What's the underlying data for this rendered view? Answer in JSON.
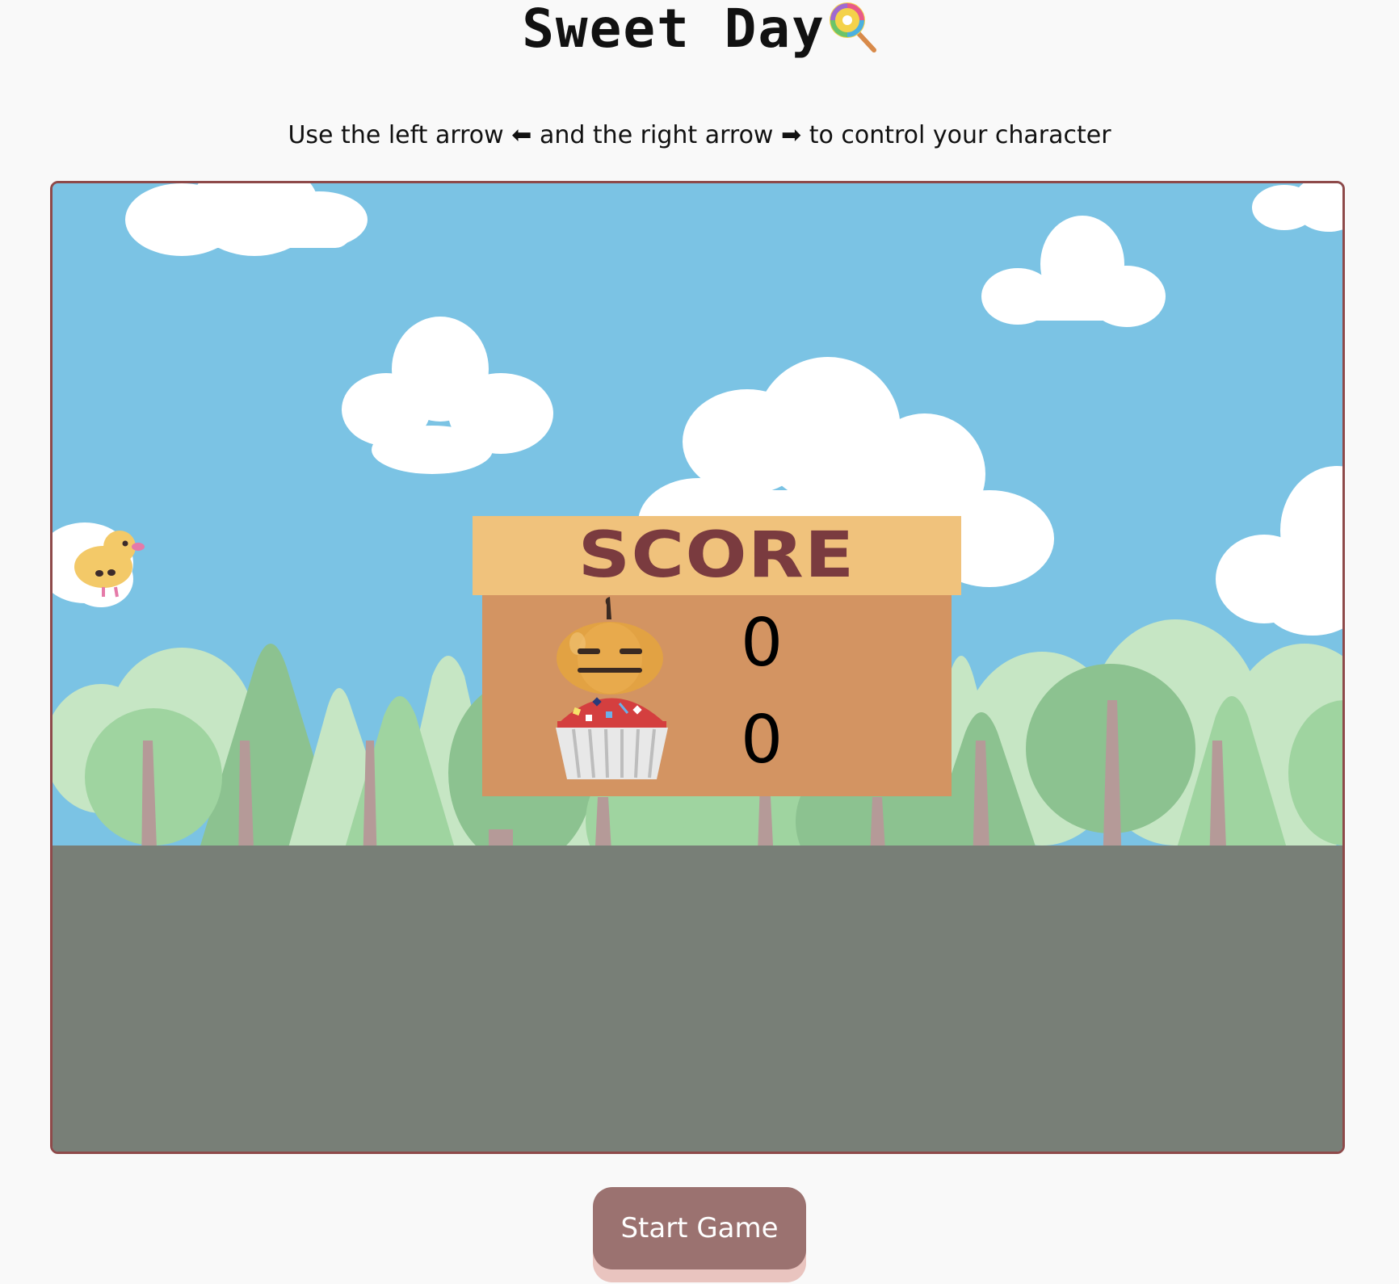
{
  "header": {
    "title": "Sweet Day",
    "title_icon": "lollipop-icon"
  },
  "instructions": {
    "text_before": "Use the left arrow",
    "left_arrow_glyph": "⬅",
    "text_middle": "and the right arrow",
    "right_arrow_glyph": "➡",
    "text_after": "to control your character"
  },
  "game": {
    "character": "yellow-chick",
    "scoreboard": {
      "title": "SCORE",
      "rows": [
        {
          "icon": "pumpkin-icon",
          "value": "0"
        },
        {
          "icon": "cupcake-icon",
          "value": "0"
        }
      ]
    },
    "colors": {
      "sky": "#7bc3e4",
      "ground": "#787f77",
      "frame_border": "#8e4a4a",
      "score_header": "#f0c27c",
      "score_body": "#d39462",
      "score_title": "#7a3b3f"
    }
  },
  "controls": {
    "start_label": "Start Game"
  }
}
